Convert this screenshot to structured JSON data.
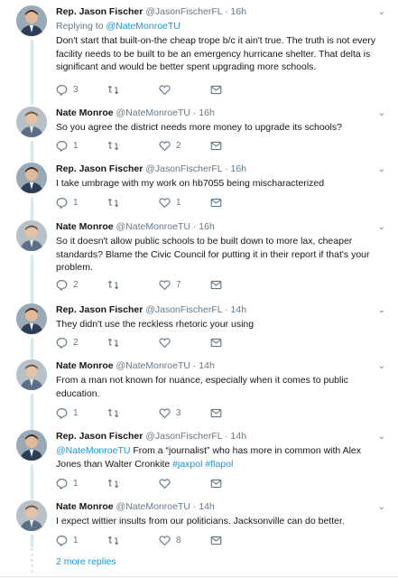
{
  "tweets": [
    {
      "name": "Rep. Jason Fischer",
      "handle": "@JasonFischerFL",
      "sep": "·",
      "time": "16h",
      "replying_prefix": "Replying to ",
      "replying_handle": "@NateMonroeTU",
      "text": "Don't start that built-on-the cheap trope b/c it ain't true. The truth is not every facility needs to be built to be an emergency hurricane shelter. That delta is significant and would be better spent upgrading more schools.",
      "replies": "3",
      "retweets": "",
      "likes": "",
      "avatar": "fischer"
    },
    {
      "name": "Nate Monroe",
      "handle": "@NateMonroeTU",
      "sep": "·",
      "time": "16h",
      "text": "So you agree the district needs more money to upgrade its schools?",
      "replies": "1",
      "retweets": "",
      "likes": "2",
      "avatar": "monroe"
    },
    {
      "name": "Rep. Jason Fischer",
      "handle": "@JasonFischerFL",
      "sep": "·",
      "time": "16h",
      "text": "I take umbrage with my work on hb7055 being mischaracterized",
      "replies": "1",
      "retweets": "",
      "likes": "1",
      "avatar": "fischer"
    },
    {
      "name": "Nate Monroe",
      "handle": "@NateMonroeTU",
      "sep": "·",
      "time": "16h",
      "text": "So it doesn't allow public schools to be built down to more lax, cheaper standards? Blame the Civic Council for putting it in their report if that's your problem.",
      "replies": "2",
      "retweets": "",
      "likes": "7",
      "avatar": "monroe"
    },
    {
      "name": "Rep. Jason Fischer",
      "handle": "@JasonFischerFL",
      "sep": "·",
      "time": "14h",
      "text": "They didn't use the reckless rhetoric your using",
      "replies": "2",
      "retweets": "",
      "likes": "",
      "avatar": "fischer"
    },
    {
      "name": "Nate Monroe",
      "handle": "@NateMonroeTU",
      "sep": "·",
      "time": "14h",
      "text": "From a man not known for nuance, especially when it comes to public education.",
      "replies": "1",
      "retweets": "",
      "likes": "3",
      "avatar": "monroe"
    },
    {
      "name": "Rep. Jason Fischer",
      "handle": "@JasonFischerFL",
      "sep": "·",
      "time": "14h",
      "text_mention": "@NateMonroeTU",
      "text_mid": " From a “journalist” who has more in common with Alex Jones than Walter Cronkite ",
      "hashtag1": "#jaxpol",
      "hashtag2": "#flapol",
      "replies": "1",
      "retweets": "",
      "likes": "",
      "avatar": "fischer"
    },
    {
      "name": "Nate Monroe",
      "handle": "@NateMonroeTU",
      "sep": "·",
      "time": "14h",
      "text": "I expect wittier insults from our politicians. Jacksonville can do better.",
      "replies": "1",
      "retweets": "",
      "likes": "8",
      "avatar": "monroe"
    }
  ],
  "more_replies": "2 more replies",
  "colors": {
    "link": "#1b95e0",
    "muted": "#657786",
    "text": "#14171a",
    "thread_line": "#dbe6ee"
  },
  "icons": [
    "reply-icon",
    "retweet-icon",
    "like-icon",
    "message-icon",
    "chevron-down-icon"
  ]
}
